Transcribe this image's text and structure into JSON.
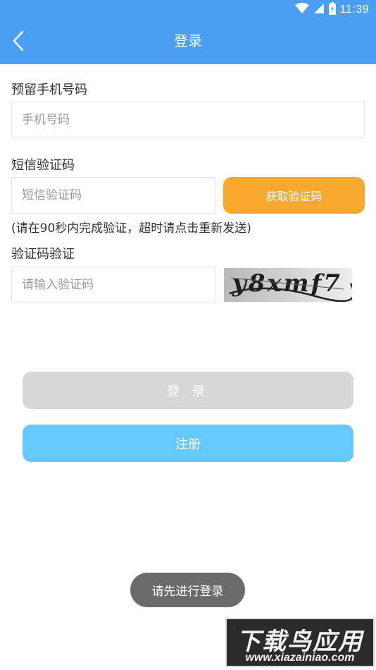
{
  "status_bar": {
    "time": "11:39"
  },
  "header": {
    "title": "登录"
  },
  "form": {
    "phone": {
      "label": "预留手机号码",
      "placeholder": "手机号码",
      "value": ""
    },
    "sms": {
      "label": "短信验证码",
      "placeholder": "短信验证码",
      "value": "",
      "button_label": "获取验证码"
    },
    "hint": "(请在90秒内完成验证，超时请点击重新发送)",
    "captcha": {
      "label": "验证码验证",
      "placeholder": "请输入验证码",
      "value": "",
      "image_text": "y8xmf7"
    }
  },
  "actions": {
    "login_label": "登 录",
    "register_label": "注册"
  },
  "toast": {
    "text": "请先进行登录"
  },
  "watermark": {
    "line1": "下载鸟应用",
    "line2": "www.xiazainiao.com"
  },
  "colors": {
    "primary": "#4a9ff5",
    "orange": "#f9a92d",
    "register": "#66c9fc",
    "disabled": "#d7d7d7"
  }
}
